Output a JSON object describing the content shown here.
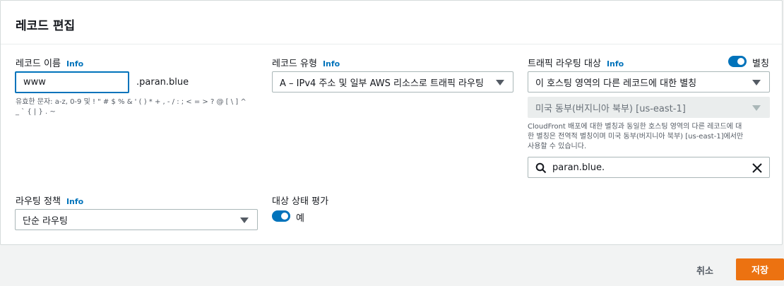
{
  "title": "레코드 편집",
  "record_name": {
    "label": "레코드 이름",
    "info": "Info",
    "value": "www",
    "suffix": ".paran.blue",
    "hint": "유효한 문자: a-z, 0-9 및 ! \" # $ % & ' ( ) * + , - / : ; < = > ? @ [ \\ ] ^",
    "hint2": "_ ` { | } . ~"
  },
  "record_type": {
    "label": "레코드 유형",
    "info": "Info",
    "value": "A – IPv4 주소 및 일부 AWS 리소스로 트래픽 라우팅"
  },
  "traffic_target": {
    "label": "트래픽 라우팅 대상",
    "info": "Info",
    "alias_label": "별칭",
    "alias_enabled": true,
    "endpoint_value": "이 호스팅 영역의 다른 레코드에 대한 별칭",
    "region_value": "미국 동부(버지니아 북부) [us-east-1]",
    "note_line1": "CloudFront 배포에 대한 별칭과 동일한 호스팅 영역의 다른 레코드에 대",
    "note_line2": "한 별칭은 전역적 별칭이며 미국 동부(버지니아 북부) [us-east-1]에서만",
    "note_line3": "사용할 수 있습니다.",
    "search_value": "paran.blue."
  },
  "routing_policy": {
    "label": "라우팅 정책",
    "info": "Info",
    "value": "단순 라우팅"
  },
  "health": {
    "label": "대상 상태 평가",
    "toggle_label": "예",
    "enabled": true
  },
  "footer": {
    "cancel_label": "취소",
    "save_label": "저장"
  },
  "colors": {
    "accent": "#0073bb",
    "primary_button": "#ec7211"
  }
}
